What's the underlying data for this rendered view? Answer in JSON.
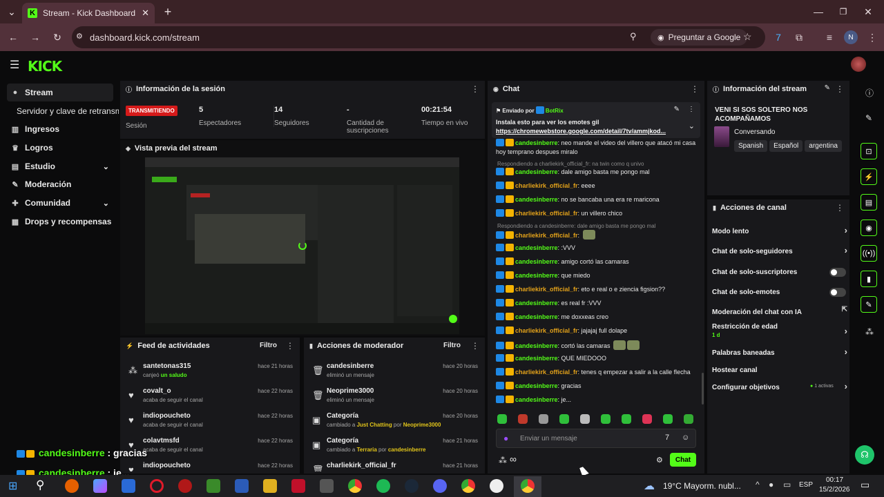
{
  "browser": {
    "tab_title": "Stream - Kick Dashboard",
    "url": "dashboard.kick.com/stream",
    "google_button": "Preguntar a Google",
    "profile_initial": "N"
  },
  "kick": {
    "logo": "KICK"
  },
  "sidebar": {
    "items": [
      {
        "label": "Stream",
        "icon": "stream-icon"
      },
      {
        "label": "Servidor y clave de retransm"
      },
      {
        "label": "Ingresos",
        "icon": "chart-icon"
      },
      {
        "label": "Logros",
        "icon": "trophy-icon"
      },
      {
        "label": "Estudio",
        "icon": "studio-icon"
      },
      {
        "label": "Moderación",
        "icon": "wrench-icon"
      },
      {
        "label": "Comunidad",
        "icon": "community-icon"
      },
      {
        "label": "Drops y recompensas",
        "icon": "gift-icon"
      }
    ]
  },
  "session": {
    "title": "Información de la sesión",
    "status": "TRANSMITIENDO",
    "session_label": "Sesión",
    "viewers_value": "5",
    "viewers_label": "Espectadores",
    "followers_value": "14",
    "followers_label": "Seguidores",
    "subs_value": "-",
    "subs_label": "Cantidad de suscripciones",
    "time_value": "00:21:54",
    "time_label": "Tiempo en vivo"
  },
  "preview": {
    "title": "Vista previa del stream"
  },
  "activity": {
    "title": "Feed de actividades",
    "filter": "Filtro",
    "items": [
      {
        "name": "santetonas315",
        "pre": "canjeó ",
        "hl": "un saludo",
        "time": "hace 21 horas"
      },
      {
        "name": "covalt_o",
        "pre": "acaba de seguir el canal",
        "hl": "",
        "time": "hace 22 horas"
      },
      {
        "name": "indiopoucheto",
        "pre": "acaba de seguir el canal",
        "hl": "",
        "time": "hace 22 horas"
      },
      {
        "name": "colavtmsfd",
        "pre": "acaba de seguir el canal",
        "hl": "",
        "time": "hace 22 horas"
      },
      {
        "name": "indiopoucheto",
        "pre": "",
        "hl": "",
        "time": "hace 22 horas"
      }
    ]
  },
  "modactions": {
    "title": "Acciones de moderador",
    "filter": "Filtro",
    "items": [
      {
        "name": "candesinberre",
        "sub": "eliminó un mensaje",
        "time": "hace 20 horas"
      },
      {
        "name": "Neoprime3000",
        "sub": "eliminó un mensaje",
        "time": "hace 20 horas"
      },
      {
        "name": "Categoría",
        "sub_a": "cambiado a ",
        "hl_a": "Just Chatting",
        "sub_b": " por ",
        "hl_b": "Neoprime3000",
        "time": "hace 20 horas"
      },
      {
        "name": "Categoría",
        "sub_a": "cambiado a ",
        "hl_a": "Terraria",
        "sub_b": " por ",
        "hl_b": "candesinberre",
        "time": "hace 21 horas"
      },
      {
        "name": "charliekirk_official_fr",
        "time": "hace 21 horas"
      }
    ]
  },
  "chat": {
    "title": "Chat",
    "pinned_by": "Enviado por",
    "pinned_user": "BotRix",
    "pinned_text": "Instala esto para ver los emotes gil",
    "pinned_link": "https://chromewebstore.google.com/detail/7tv/ammjkod...",
    "messages": [
      {
        "user": "candesinberre",
        "text": ": neo mande el video del villero que atacó mi casa hoy temprano despues miralo",
        "c": "u1"
      },
      {
        "reply": "Respondiendo a charliekirk_official_fr: na twin como q univo"
      },
      {
        "user": "candesinberre",
        "text": ": dale amigo basta me pongo mal",
        "c": "u1"
      },
      {
        "user": "charliekirk_official_fr",
        "text": ": eeee",
        "c": "u2"
      },
      {
        "user": "candesinberre",
        "text": ": no se bancaba una era re maricona",
        "c": "u1"
      },
      {
        "user": "charliekirk_official_fr",
        "text": ": un villero chico",
        "c": "u2"
      },
      {
        "reply": "Respondiendo a candesinberre: dale amigo basta me pongo mal"
      },
      {
        "user": "charliekirk_official_fr",
        "text": ": ",
        "c": "u2",
        "emote": 1
      },
      {
        "user": "candesinberre",
        "text": ": :VVV",
        "c": "u1"
      },
      {
        "user": "candesinberre",
        "text": ": amigo cortó las camaras",
        "c": "u1"
      },
      {
        "user": "candesinberre",
        "text": ": que miedo",
        "c": "u1"
      },
      {
        "user": "charliekirk_official_fr",
        "text": ": eto e real o e ziencia figsion??",
        "c": "u2"
      },
      {
        "user": "candesinberre",
        "text": ": es real fr :VVV",
        "c": "u1"
      },
      {
        "user": "candesinberre",
        "text": ": me doxxeas creo",
        "c": "u1"
      },
      {
        "user": "charliekirk_official_fr",
        "text": ": jajajaj full dolape",
        "c": "u2"
      },
      {
        "user": "candesinberre",
        "text": ": cortó las camaras ",
        "c": "u1",
        "emote": 2
      },
      {
        "user": "candesinberre",
        "text": ": QUE MIEDOOO",
        "c": "u1"
      },
      {
        "user": "charliekirk_official_fr",
        "text": ": tenes q empezar a salir a la calle flecha",
        "c": "u2"
      },
      {
        "user": "candesinberre",
        "text": ": gracias",
        "c": "u1"
      },
      {
        "user": "candesinberre",
        "text": ": je...",
        "c": "u1"
      }
    ],
    "input_placeholder": "Enviar un mensaje",
    "send_label": "Chat",
    "infinity": "∞"
  },
  "streaminfo": {
    "title": "Información del stream",
    "stream_title": "VENI SI SOS SOLTERO NOS ACOMPAÑAMOS",
    "category": "Conversando",
    "tags": [
      "Spanish",
      "Español",
      "argentina"
    ]
  },
  "channel": {
    "title": "Acciones de canal",
    "items": [
      {
        "label": "Modo lento",
        "kind": "chevron"
      },
      {
        "label": "Chat de solo-seguidores",
        "kind": "chevron"
      },
      {
        "label": "Chat de solo-suscriptores",
        "kind": "toggle"
      },
      {
        "label": "Chat de solo-emotes",
        "kind": "toggle"
      },
      {
        "label": "Moderación del chat con IA",
        "kind": "ext"
      },
      {
        "label": "Restricción de edad",
        "kind": "chevron",
        "sub": "1 d"
      },
      {
        "label": "Palabras baneadas",
        "kind": "chevron"
      },
      {
        "label": "Hostear canal",
        "kind": "none"
      },
      {
        "label": "Configurar objetivos",
        "kind": "chevron",
        "badge": "1 activas"
      }
    ]
  },
  "overlay": [
    {
      "user": "candesinberre",
      "text": " : gracias"
    },
    {
      "user": "candesinberre",
      "text": " : je..."
    }
  ],
  "taskbar": {
    "weather": "19°C  Mayorm. nubl...",
    "lang": "ESP",
    "time": "00:17",
    "date": "15/2/2026"
  }
}
